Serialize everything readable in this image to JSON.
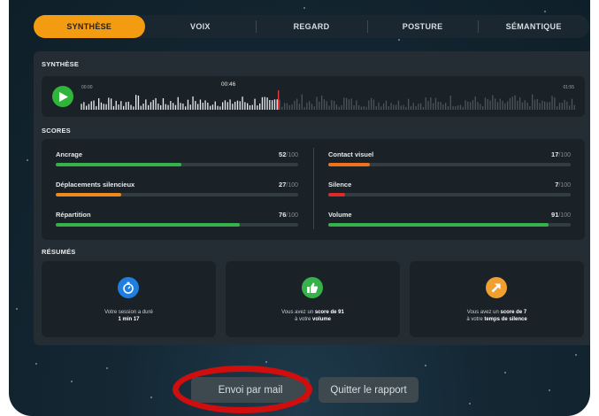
{
  "tabs": [
    {
      "label": "SYNTHÈSE",
      "active": true
    },
    {
      "label": "VOIX",
      "active": false
    },
    {
      "label": "REGARD",
      "active": false
    },
    {
      "label": "POSTURE",
      "active": false
    },
    {
      "label": "SÉMANTIQUE",
      "active": false
    }
  ],
  "synthese": {
    "title": "SYNTHÈSE",
    "player": {
      "start_time": "00:00",
      "current_time": "00:46",
      "end_time": "01:55",
      "progress": 0.4,
      "play_icon": "play-icon"
    }
  },
  "scores": {
    "title": "SCORES",
    "suffix": "/100",
    "left": [
      {
        "label": "Ancrage",
        "value": "52",
        "color": "#36b24a"
      },
      {
        "label": "Déplacements silencieux",
        "value": "27",
        "color": "#f08a1c"
      },
      {
        "label": "Répartition",
        "value": "76",
        "color": "#36b24a"
      }
    ],
    "right": [
      {
        "label": "Contact visuel",
        "value": "17",
        "color": "#f0701c"
      },
      {
        "label": "Silence",
        "value": "7",
        "color": "#e02a2a"
      },
      {
        "label": "Volume",
        "value": "91",
        "color": "#36b24a"
      }
    ]
  },
  "resumes": {
    "title": "RÉSUMÉS",
    "cards": [
      {
        "icon": "stopwatch-icon",
        "color": "#1e7fe0",
        "line1": "Votre session a duré",
        "line2_bold": "1 min 17"
      },
      {
        "icon": "thumbs-up-icon",
        "color": "#36b24a",
        "line1_pre": "Vous avez un ",
        "line1_bold": "score de 91",
        "line2_pre": "à votre ",
        "line2_bold": "volume"
      },
      {
        "icon": "arrow-up-right-icon",
        "color": "#f0a030",
        "line1_pre": "Vous avez un ",
        "line1_bold": "score de 7",
        "line2_pre": "à votre ",
        "line2_bold": "temps de silence"
      }
    ]
  },
  "actions": {
    "mail_label": "Envoi par mail",
    "quit_label": "Quitter le rapport"
  },
  "colors": {
    "accent": "#f39c12",
    "highlight_ring": "#d00e0e"
  }
}
